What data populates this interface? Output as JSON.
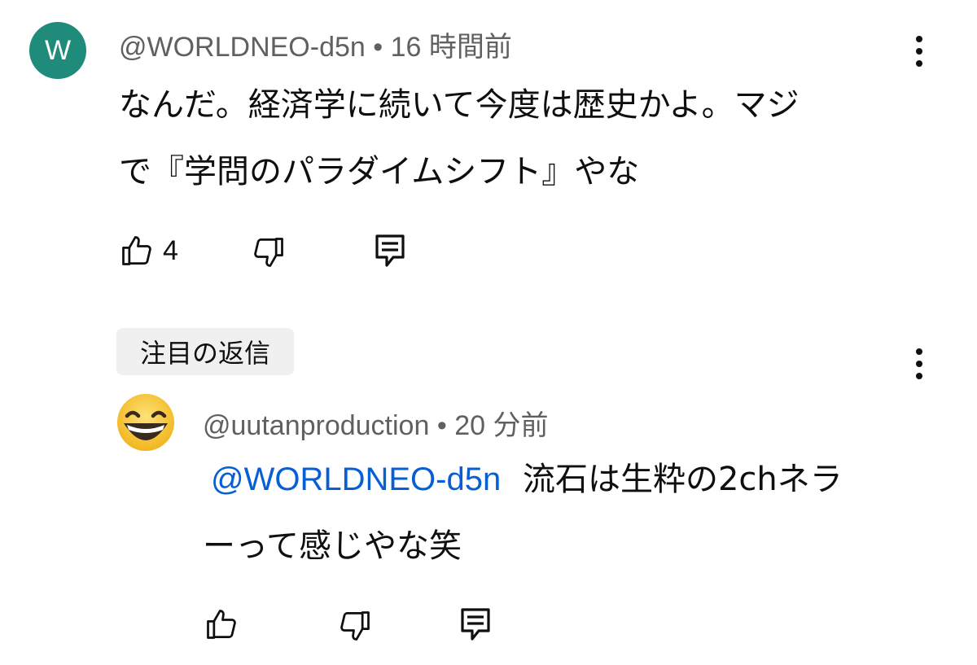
{
  "comment": {
    "avatar_letter": "W",
    "author": "@WORLDNEO-d5n",
    "separator": "•",
    "time": "16 時間前",
    "text_line1": "なんだ。経済学に続いて今度は歴史かよ。マジ",
    "text_line2": "で『学問のパラダイムシフト』やな",
    "like_count": "4",
    "icons": {
      "like": "thumbs-up-icon",
      "dislike": "thumbs-down-icon",
      "reply": "reply-icon",
      "menu": "more-vert-icon"
    }
  },
  "reply": {
    "badge": "注目の返信",
    "avatar": "smiling-face-emoji",
    "author": "@uutanproduction",
    "separator": "•",
    "time": "20 分前",
    "mention": "@WORLDNEO-d5n",
    "text_line1_rest": "流石は生粋の2chネラ",
    "text_line2": "ーって感じやな笑"
  },
  "colors": {
    "avatar_bg": "#1f8b7a",
    "mention": "#065fd4",
    "meta": "#606060",
    "badge_bg": "#f0f0f0"
  }
}
